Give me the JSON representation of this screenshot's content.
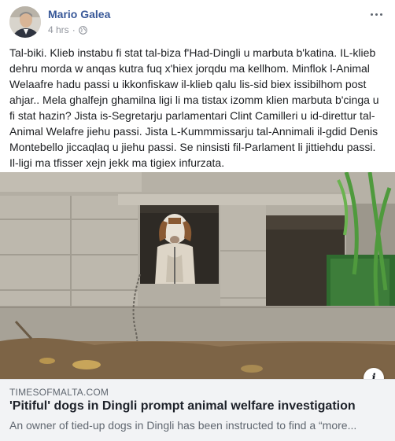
{
  "post": {
    "author": "Mario Galea",
    "time": "4 hrs",
    "separator": "·",
    "privacy_icon": "globe-icon",
    "body": "Tal-biki. Klieb instabu fi stat tal-biza f'Had-Dingli u marbuta b'katina. IL-klieb dehru morda w anqas kutra fuq x'hiex jorqdu ma kellhom. Minflok l-Animal Welaafre hadu passi u ikkonfiskaw il-klieb qalu lis-sid biex issibilhom post ahjar.. Mela ghalfejn ghamilna ligi li ma tistax izomm klien marbuta b'cinga u fi stat hazin? Jista is-Segretarju parlamentari Clint Camilleri u id-direttur tal-Animal Welafre jiehu passi. Jista L-Kummmissarju tal-Annimali il-gdid Denis Montebello jiccaqlaq u jiehu passi. Se ninsisti fil-Parlament li jittiehdu passi. Il-ligi ma tfisser xejn jekk ma tigiex infurzata."
  },
  "link": {
    "domain": "TIMESOFMALTA.COM",
    "title": "'Pitiful' dogs in Dingli prompt animal welfare investigation",
    "description": "An owner of tied-up dogs in Dingli has been instructed to find a “more..."
  },
  "icons": {
    "more": "more-options-icon",
    "info": "info-icon",
    "info_glyph": "i"
  },
  "colors": {
    "author_link": "#385898",
    "meta_gray": "#90949c",
    "link_box_bg": "#f2f3f5"
  }
}
